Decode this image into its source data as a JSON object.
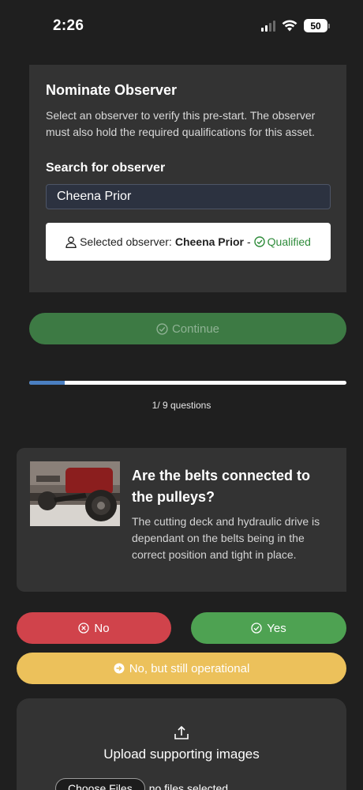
{
  "status_bar": {
    "time": "2:26",
    "battery": "50"
  },
  "observer": {
    "title": "Nominate Observer",
    "description": "Select an observer to verify this pre-start. The observer must also hold the required qualifications for this asset.",
    "search_label": "Search for observer",
    "search_value": "Cheena Prior",
    "selected_prefix": "Selected observer:",
    "selected_name": "Cheena Prior",
    "separator": "-",
    "qualified_label": "Qualified",
    "qualified_color": "#2e8b3a"
  },
  "continue_label": "Continue",
  "progress": {
    "text": "1/ 9 questions",
    "current": 1,
    "total": 9
  },
  "question": {
    "title": "Are the belts connected to the pulleys?",
    "description": "The cutting deck and hydraulic drive is dependant on the belts being in the correct position and tight in place."
  },
  "answers": {
    "no_label": "No",
    "yes_label": "Yes",
    "operational_label": "No, but still operational",
    "no_color": "#d0434b",
    "yes_color": "#4ea252",
    "operational_color": "#ecc15b"
  },
  "upload": {
    "label": "Upload supporting images",
    "choose_label": "Choose Files",
    "status": "no files selected"
  }
}
